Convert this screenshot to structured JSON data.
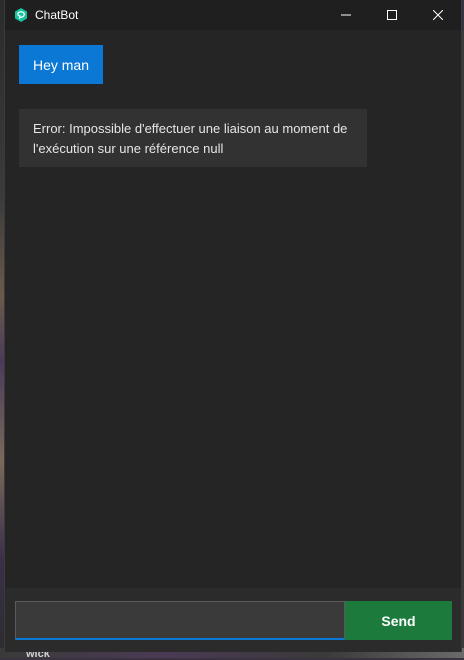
{
  "window": {
    "title": "ChatBot",
    "app_icon": "chatbot-logo-icon",
    "controls": [
      "minimize-icon",
      "maximize-icon",
      "close-icon"
    ]
  },
  "chat": {
    "messages": [
      {
        "role": "user",
        "text": "Hey man"
      },
      {
        "role": "bot",
        "text": "Error: Impossible d'effectuer une liaison au moment de l'exécution sur une référence null"
      }
    ]
  },
  "composer": {
    "input_value": "",
    "send_label": "Send"
  },
  "desktop": {
    "background_text": "wick"
  },
  "colors": {
    "accent": "#0a78d4",
    "send_button": "#1b7a3c",
    "window_bg": "#202020",
    "chat_bg": "#252525",
    "bot_bubble": "#323232"
  }
}
